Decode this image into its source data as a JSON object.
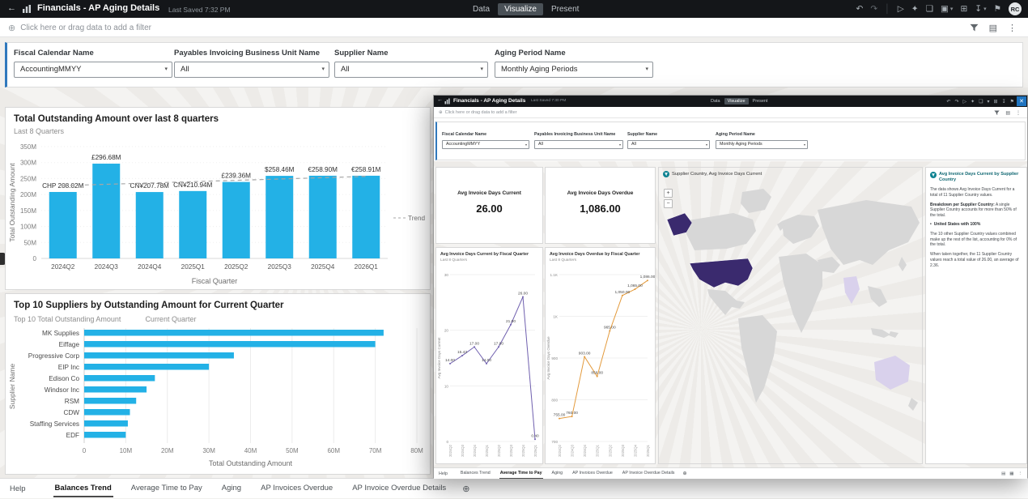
{
  "colors": {
    "header_bg": "#141619",
    "accent_blue": "#3079bd",
    "bar": "#23b1e6",
    "trend": "#a6a6a6",
    "line_current": "#6f5fae",
    "line_overdue": "#e39a3c",
    "map_base": "#d7d7d7",
    "map_high": "#3a2a6e",
    "map_low": "#d9d1ec",
    "insight_teal": "#0e8291"
  },
  "icons": {
    "back": "←",
    "undo": "↶",
    "redo": "↷",
    "divider": "│",
    "present_play": "▷",
    "auto_insights": "✦",
    "print": "❏",
    "comment": "▣",
    "caret": "▾",
    "schedule": "⊞",
    "export": "↧",
    "bookmark": "⚑",
    "add": "⊕",
    "grid": "▤",
    "grid2": "▦",
    "kebab": "⋮",
    "close": "✕",
    "zoom_in": "+",
    "zoom_out": "−",
    "bullet": "•"
  },
  "header": {
    "title": "Financials - AP Aging Details",
    "last_saved": "Last Saved 7:32 PM",
    "nav": {
      "data": "Data",
      "visualize": "Visualize",
      "present": "Present"
    },
    "avatar": "RC"
  },
  "filter_bar": {
    "hint": "Click here or drag data to add a filter"
  },
  "filters": [
    {
      "label": "Fiscal Calendar Name",
      "value": "AccountingMMYY"
    },
    {
      "label": "Payables Invoicing Business Unit Name",
      "value": "All"
    },
    {
      "label": "Supplier Name",
      "value": "All"
    },
    {
      "label": "Aging Period Name",
      "value": "Monthly Aging Periods"
    }
  ],
  "bottom_tabs": {
    "help": "Help",
    "items": [
      "Balances Trend",
      "Average Time to Pay",
      "Aging",
      "AP Invoices Overdue",
      "AP Invoice Overdue Details"
    ],
    "active": "Balances Trend"
  },
  "chart_data": [
    {
      "id": "total-outstanding-by-quarter",
      "type": "bar",
      "title": "Total Outstanding Amount over last 8 quarters",
      "subtitle": "Last 8 Quarters",
      "categories": [
        "2024Q2",
        "2024Q3",
        "2024Q4",
        "2025Q1",
        "2025Q2",
        "2025Q3",
        "2025Q4",
        "2026Q1"
      ],
      "values": [
        208.02,
        296.68,
        207.78,
        210.94,
        239.36,
        258.46,
        258.9,
        258.91
      ],
      "value_labels": [
        "CHP 208.02M",
        "£296.68M",
        "CN¥207.78M",
        "CN¥210.94M",
        "£239.36M",
        "$258.46M",
        "€258.90M",
        "€258.91M"
      ],
      "unit": "M",
      "ylim": [
        0,
        350
      ],
      "yticks": [
        "350M",
        "300M",
        "250M",
        "200M",
        "150M",
        "100M",
        "50M",
        "0"
      ],
      "xlabel": "Fiscal Quarter",
      "ylabel": "Total Outstanding Amount",
      "legend": "Trend",
      "trend": true
    },
    {
      "id": "top-suppliers-current-quarter",
      "type": "bar-horizontal",
      "title": "Top 10 Suppliers by Outstanding Amount for Current Quarter",
      "legend1": "Top 10 Total Outstanding Amount",
      "legend2": "Current Quarter",
      "categories": [
        "MK Supplies",
        "Eiffage",
        "Progressive Corp",
        "EIP Inc",
        "Edison Co",
        "Windsor Inc",
        "RSM",
        "CDW",
        "Staffing Services",
        "EDF"
      ],
      "values": [
        72,
        70,
        36,
        30,
        17,
        15,
        12.5,
        11,
        10.5,
        10
      ],
      "xlim": [
        0,
        80
      ],
      "xticks": [
        "0",
        "10M",
        "20M",
        "30M",
        "40M",
        "50M",
        "60M",
        "70M",
        "80M"
      ],
      "xlabel": "Total Outstanding Amount",
      "ylabel": "Supplier Name"
    },
    {
      "id": "avg-invoice-days-current-trend",
      "type": "line",
      "title": "Avg Invoice Days Current by Fiscal Quarter",
      "subtitle": "Last 8 Quarters",
      "categories": [
        "2024Q2",
        "2024Q3",
        "2024Q4",
        "2025Q1",
        "2025Q2",
        "2025Q3",
        "2025Q4",
        "2026Q1"
      ],
      "values": [
        14,
        15.43,
        17,
        14,
        17,
        21,
        26,
        0.4
      ],
      "value_labels": [
        "14.00",
        "15.43",
        "17.00",
        "14.00",
        "17.00",
        "21.00",
        "26.00",
        "0.40"
      ],
      "ylim": [
        0,
        30
      ],
      "yticks": [
        "30",
        "20",
        "10",
        "0"
      ],
      "ylabel": "Avg Invoice Days Current"
    },
    {
      "id": "avg-invoice-days-overdue-trend",
      "type": "line",
      "title": "Avg Invoice Days Overdue by Fiscal Quarter",
      "subtitle": "Last 8 Quarters",
      "categories": [
        "2024Q2",
        "2024Q3",
        "2024Q4",
        "2025Q1",
        "2025Q2",
        "2025Q3",
        "2025Q4",
        "2026Q1"
      ],
      "values": [
        755,
        760,
        903,
        856,
        965,
        1050,
        1065,
        1086
      ],
      "value_labels": [
        "755.00",
        "760.00",
        "903.00",
        "856.00",
        "965.00",
        "1,050.00",
        "1,065.00",
        "1,086.00"
      ],
      "ylim": [
        700,
        1100
      ],
      "yticks": [
        "1.1K",
        "1K",
        "900",
        "800",
        "700"
      ],
      "ylabel": "Avg Invoice Days Overdue"
    }
  ],
  "overlay": {
    "header": {
      "title": "Financials - AP Aging Details",
      "last_saved": "Last Saved 7:30 PM",
      "nav": {
        "data": "Data",
        "visualize": "Visualize",
        "present": "Present"
      }
    },
    "filter_hint": "Click here or drag data to add a filter",
    "kpis": [
      {
        "title": "Avg Invoice Days Current",
        "value": "26.00"
      },
      {
        "title": "Avg Invoice Days Overdue",
        "value": "1,086.00"
      }
    ],
    "map": {
      "title": "Supplier Country, Avg Invoice Days Current",
      "highlight": "United States"
    },
    "insight": {
      "title": "Avg Invoice Days Current by Supplier Country",
      "p1": "The data shows Avg Invoice Days Current for a total of 11 Supplier Country values.",
      "breakdown_title": "Breakdown per Supplier Country:",
      "p2": "A single Supplier Country accounts for more than 50% of the total.",
      "bullet": "United States with 100%",
      "p3": "The 10 other Supplier Country values combined make up the rest of the list, accounting for 0% of the total.",
      "p4": "When taken together, the 11 Supplier Country values reach a total value of 26.00, an average of 2.36."
    },
    "tabs": {
      "help": "Help",
      "items": [
        "Balances Trend",
        "Average Time to Pay",
        "Aging",
        "AP Invoices Overdue",
        "AP Invoice Overdue Details"
      ],
      "active": "Average Time to Pay"
    }
  }
}
